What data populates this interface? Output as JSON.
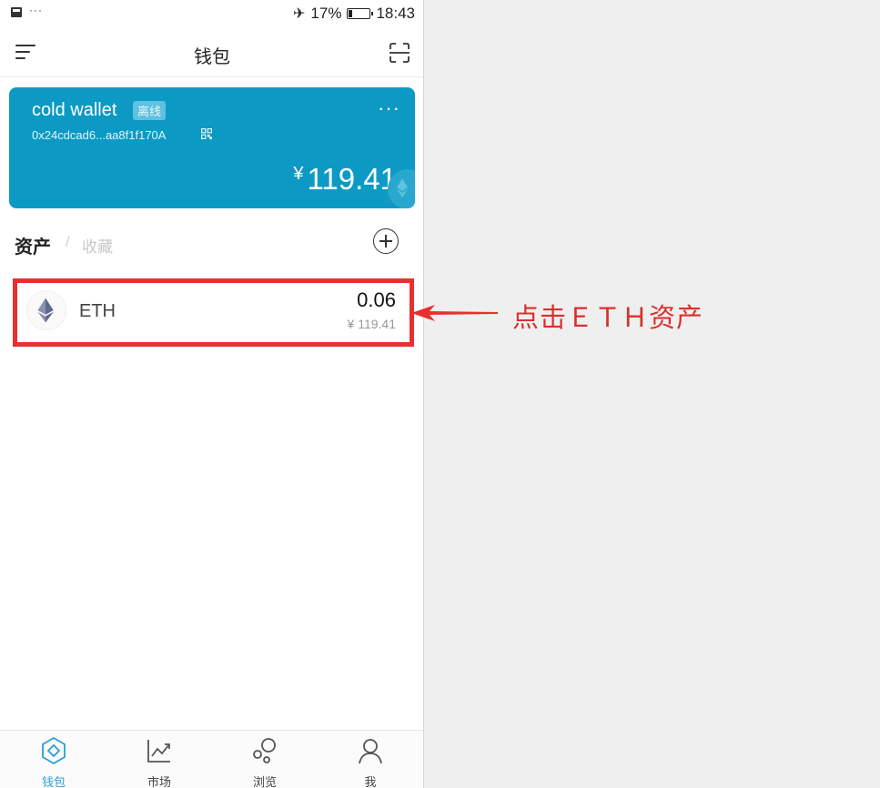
{
  "status_bar": {
    "notification_dots": "···",
    "battery_percent": "17%",
    "battery_level": 0.17,
    "time": "18:43"
  },
  "nav": {
    "title": "钱包"
  },
  "wallet_card": {
    "name": "cold wallet",
    "badge": "离线",
    "more": "···",
    "address": "0x24cdcad6...aa8f1f170A",
    "currency_symbol": "¥",
    "balance": "119.41",
    "background_color": "#0c9ac4"
  },
  "assets": {
    "tab_assets": "资产",
    "separator": "/",
    "tab_collect": "收藏",
    "items": [
      {
        "symbol": "ETH",
        "amount": "0.06",
        "fiat_value": "¥ 119.41",
        "icon": "ethereum-icon"
      }
    ]
  },
  "tab_bar": {
    "active_color": "#2a9fd6",
    "items": [
      {
        "label": "钱包",
        "icon": "wallet-icon",
        "active": true
      },
      {
        "label": "市场",
        "icon": "market-chart-icon",
        "active": false
      },
      {
        "label": "浏览",
        "icon": "browse-bubbles-icon",
        "active": false
      },
      {
        "label": "我",
        "icon": "profile-icon",
        "active": false
      }
    ]
  },
  "annotation": {
    "text": "点击ＥＴＨ资产",
    "color": "#e8302f"
  }
}
